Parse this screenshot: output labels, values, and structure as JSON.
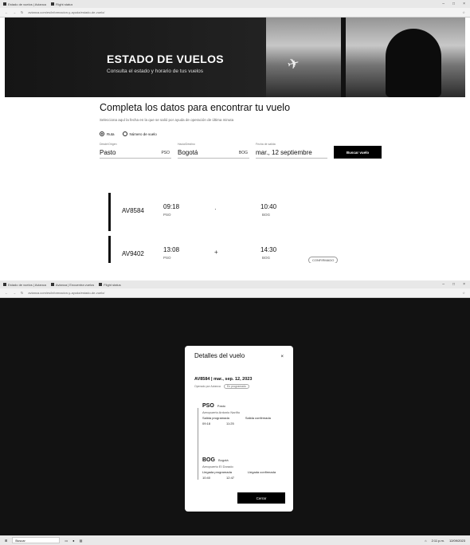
{
  "browser1": {
    "tabs": [
      "Estado de vuelos | Avianca",
      "Flight status"
    ],
    "url": "avianca.com/es/informacion-y-ayuda/estado-de-vuelo/"
  },
  "hero": {
    "title": "ESTADO DE VUELOS",
    "subtitle": "Consulta el estado y horario de tus vuelos"
  },
  "form": {
    "heading": "Completa los datos para encontrar tu vuelo",
    "desc": "Selecciona aquí la fecha en la que se salió por ayuda de operación de última minuta",
    "radio1": "Ruta",
    "radio2": "Número de vuelo",
    "origin_label": "Desde/Origen",
    "origin_value": "Pasto",
    "origin_code": "PSO",
    "dest_label": "Hacia/Destino",
    "dest_value": "Bogotá",
    "dest_code": "BOG",
    "date_label": "Fecha de salida",
    "date_value": "mar., 12 septiembre",
    "search_button": "Buscar vuelo"
  },
  "flights": [
    {
      "number": "AV8584",
      "dep_time": "09:18",
      "dep_code": "PSO",
      "arr_time": "10:40",
      "arr_code": "BOG"
    },
    {
      "number": "AV9402",
      "dep_time": "13:08",
      "dep_code": "PSO",
      "arr_time": "14:30",
      "arr_code": "BOG",
      "status": "CONFIRMADO"
    }
  ],
  "browser2": {
    "tabs": [
      "Estado de vuelos | Avianca",
      "Avianca | Encuentra vuelos",
      "Flight status"
    ],
    "url": "avianca.com/es/informacion-y-ayuda/estado-de-vuelo/"
  },
  "modal": {
    "title": "Detalles del vuelo",
    "close_x": "×",
    "flight_line": "AV8584 | mar., sep. 12, 2023",
    "operated": "Operado por Avianca",
    "pill": "En programado",
    "origin_code": "PSO",
    "origin_city": "Pasto",
    "origin_airport": "Aeropuerto Antonio Nariño",
    "origin_sched": "Salida programada",
    "origin_conf": "Salida confirmada",
    "origin_t1": "09:18",
    "origin_t2": "11:25",
    "dest_code": "BOG",
    "dest_city": "Bogotá",
    "dest_airport": "Aeropuerto El Dorado",
    "dest_sched": "Llegada programada",
    "dest_conf": "Llegada confirmada",
    "dest_t1": "10:40",
    "dest_t2": "12:47",
    "close_button": "Cerrar"
  },
  "taskbar": {
    "search": "Buscar",
    "time": "2:11 p.m.",
    "date": "12/09/2023"
  }
}
